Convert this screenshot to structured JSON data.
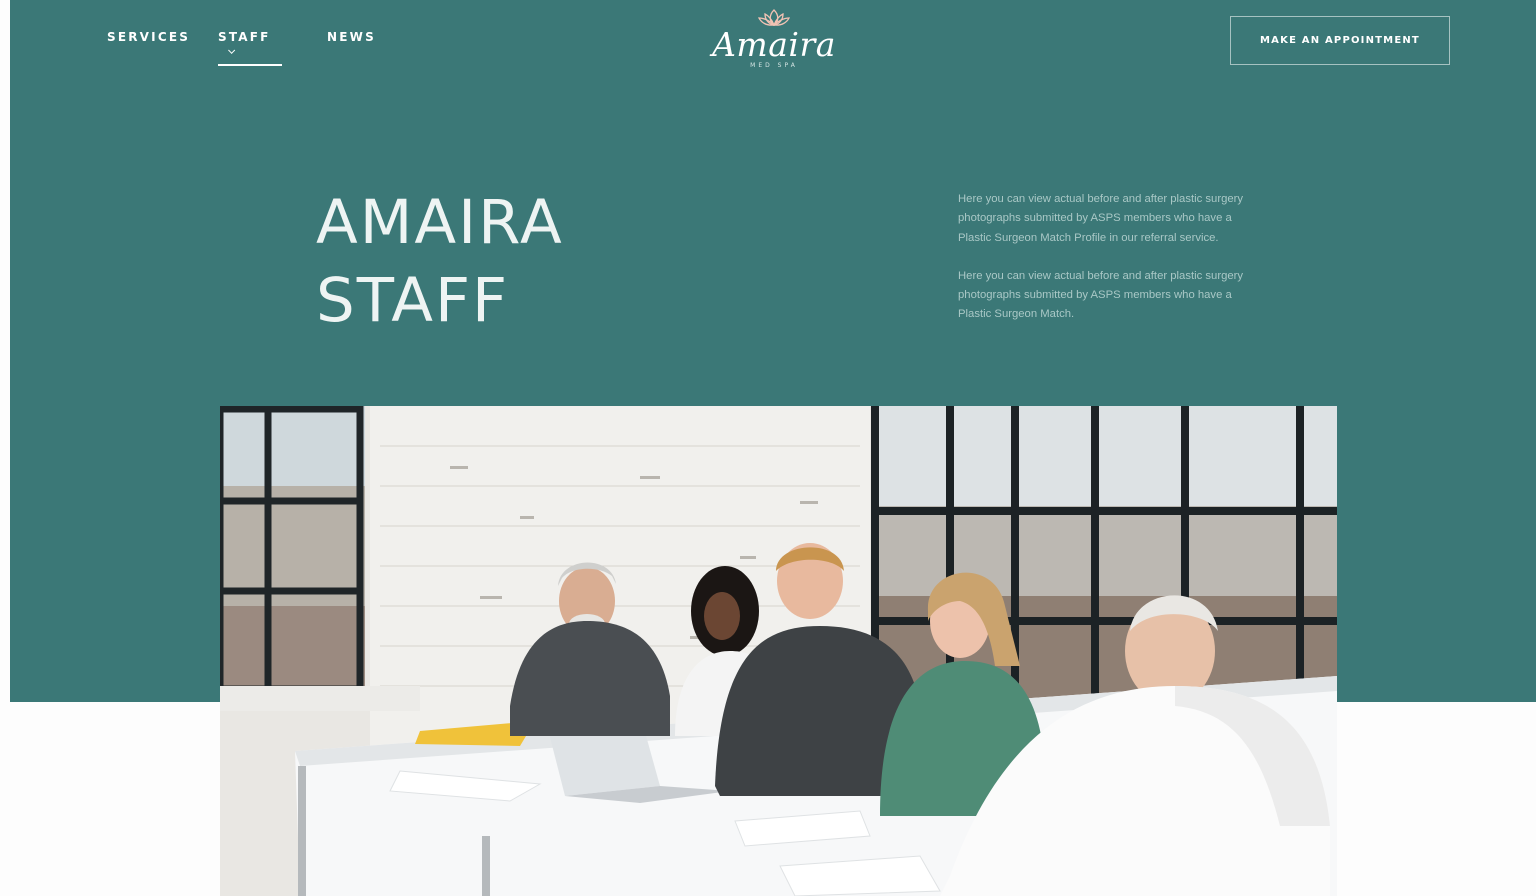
{
  "nav": {
    "items": [
      {
        "label": "SERVICES"
      },
      {
        "label": "STAFF"
      },
      {
        "label": "NEWS"
      }
    ],
    "staff_chevron_icon": "chevron-down-icon"
  },
  "logo": {
    "name": "Amaira",
    "subtitle": "MED SPA",
    "icon": "lotus-icon"
  },
  "appointment_button": {
    "label": "MAKE AN APPOINTMENT"
  },
  "hero": {
    "title_line1": "AMAIRA",
    "title_line2": "STAFF",
    "paragraph1": "Here you can view actual before and after plastic surgery photographs submitted by ASPS members who have a Plastic Surgeon Match Profile in our referral service.",
    "paragraph2": "Here you can view actual before and after plastic surgery photographs submitted by ASPS members who have a Plastic Surgeon Match."
  },
  "colors": {
    "teal": "#3b7877",
    "text_white": "#ffffff",
    "paragraph": "#a9c8c6",
    "lotus": "#f2c3b4"
  }
}
